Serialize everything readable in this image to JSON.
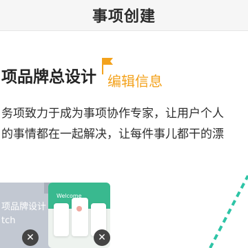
{
  "header": {
    "title": "事项创建"
  },
  "project": {
    "title": "项品牌总设计",
    "edit_label": "编辑信息",
    "description_lines": [
      "务项致力于成为事项协作专家，让用户个人",
      "的事情都在一起解决，让每件事儿都干的漂"
    ]
  },
  "attachments": [
    {
      "line1": "项品牌设计",
      "line2": "tch",
      "close_icon": "close-icon"
    },
    {
      "band_text": "Welcome",
      "close_icon": "close-icon"
    }
  ],
  "colors": {
    "accent": "#f3a21c",
    "teal": "#2ec4a6",
    "thumb_green": "#39b98f"
  }
}
